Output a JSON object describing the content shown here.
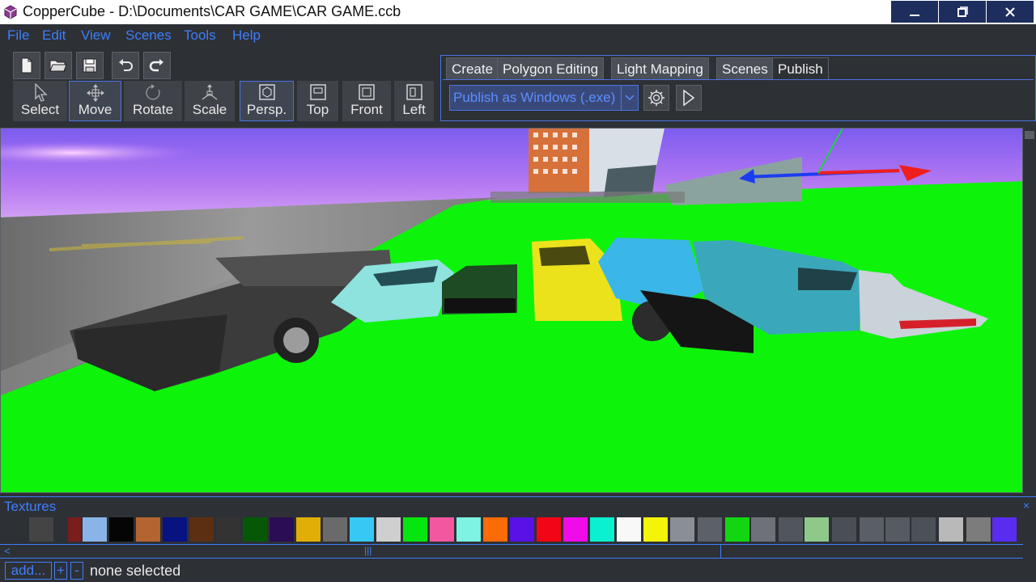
{
  "app": {
    "title": "CopperCube - D:\\Documents\\CAR GAME\\CAR GAME.ccb"
  },
  "window_controls": {
    "minimize": "minimize-icon",
    "restore": "restore-icon",
    "close": "close-icon"
  },
  "menu": [
    "File",
    "Edit",
    "View",
    "Scenes",
    "Tools",
    "Help"
  ],
  "file_buttons": [
    "new-file-icon",
    "open-folder-icon",
    "save-icon",
    "undo-icon",
    "redo-icon"
  ],
  "tools": [
    {
      "label": "Select",
      "icon": "cursor-icon"
    },
    {
      "label": "Move",
      "icon": "move-icon",
      "active": true
    },
    {
      "label": "Rotate",
      "icon": "rotate-icon"
    },
    {
      "label": "Scale",
      "icon": "scale-icon"
    }
  ],
  "views": [
    {
      "label": "Persp.",
      "icon": "perspective-icon",
      "active": true
    },
    {
      "label": "Top",
      "icon": "top-view-icon"
    },
    {
      "label": "Front",
      "icon": "front-view-icon"
    },
    {
      "label": "Left",
      "icon": "left-view-icon"
    }
  ],
  "tabs": [
    "Create",
    "Polygon Editing",
    "Light Mapping",
    "Scenes",
    "Publish"
  ],
  "active_tab": "Publish",
  "publish": {
    "target": "Publish as Windows (.exe)",
    "settings_icon": "gear-icon",
    "run_icon": "play-icon"
  },
  "textures": {
    "title": "Textures",
    "close": "×",
    "swatch_colors": [
      "#8ab3e8",
      "#050505",
      "#b36431",
      "#071380",
      "#5c2f12",
      "#333333",
      "#065806",
      "#2a0d52",
      "#e0ae07",
      "#6a6a6a",
      "#37c8f3",
      "#cfcfcf",
      "#05e50f",
      "#f257a0",
      "#7ff3e3",
      "#fb6b06",
      "#5911e6",
      "#f20515",
      "#f00be9",
      "#0bf0ce",
      "#f8f8f8",
      "#f3f407"
    ]
  },
  "footer": {
    "add": "add...",
    "plus": "+",
    "minus": "-",
    "status": "none selected"
  },
  "colors": {
    "accent": "#3f7ffc",
    "panel": "#2d3035",
    "title_buttons": "#1d2e5e"
  }
}
